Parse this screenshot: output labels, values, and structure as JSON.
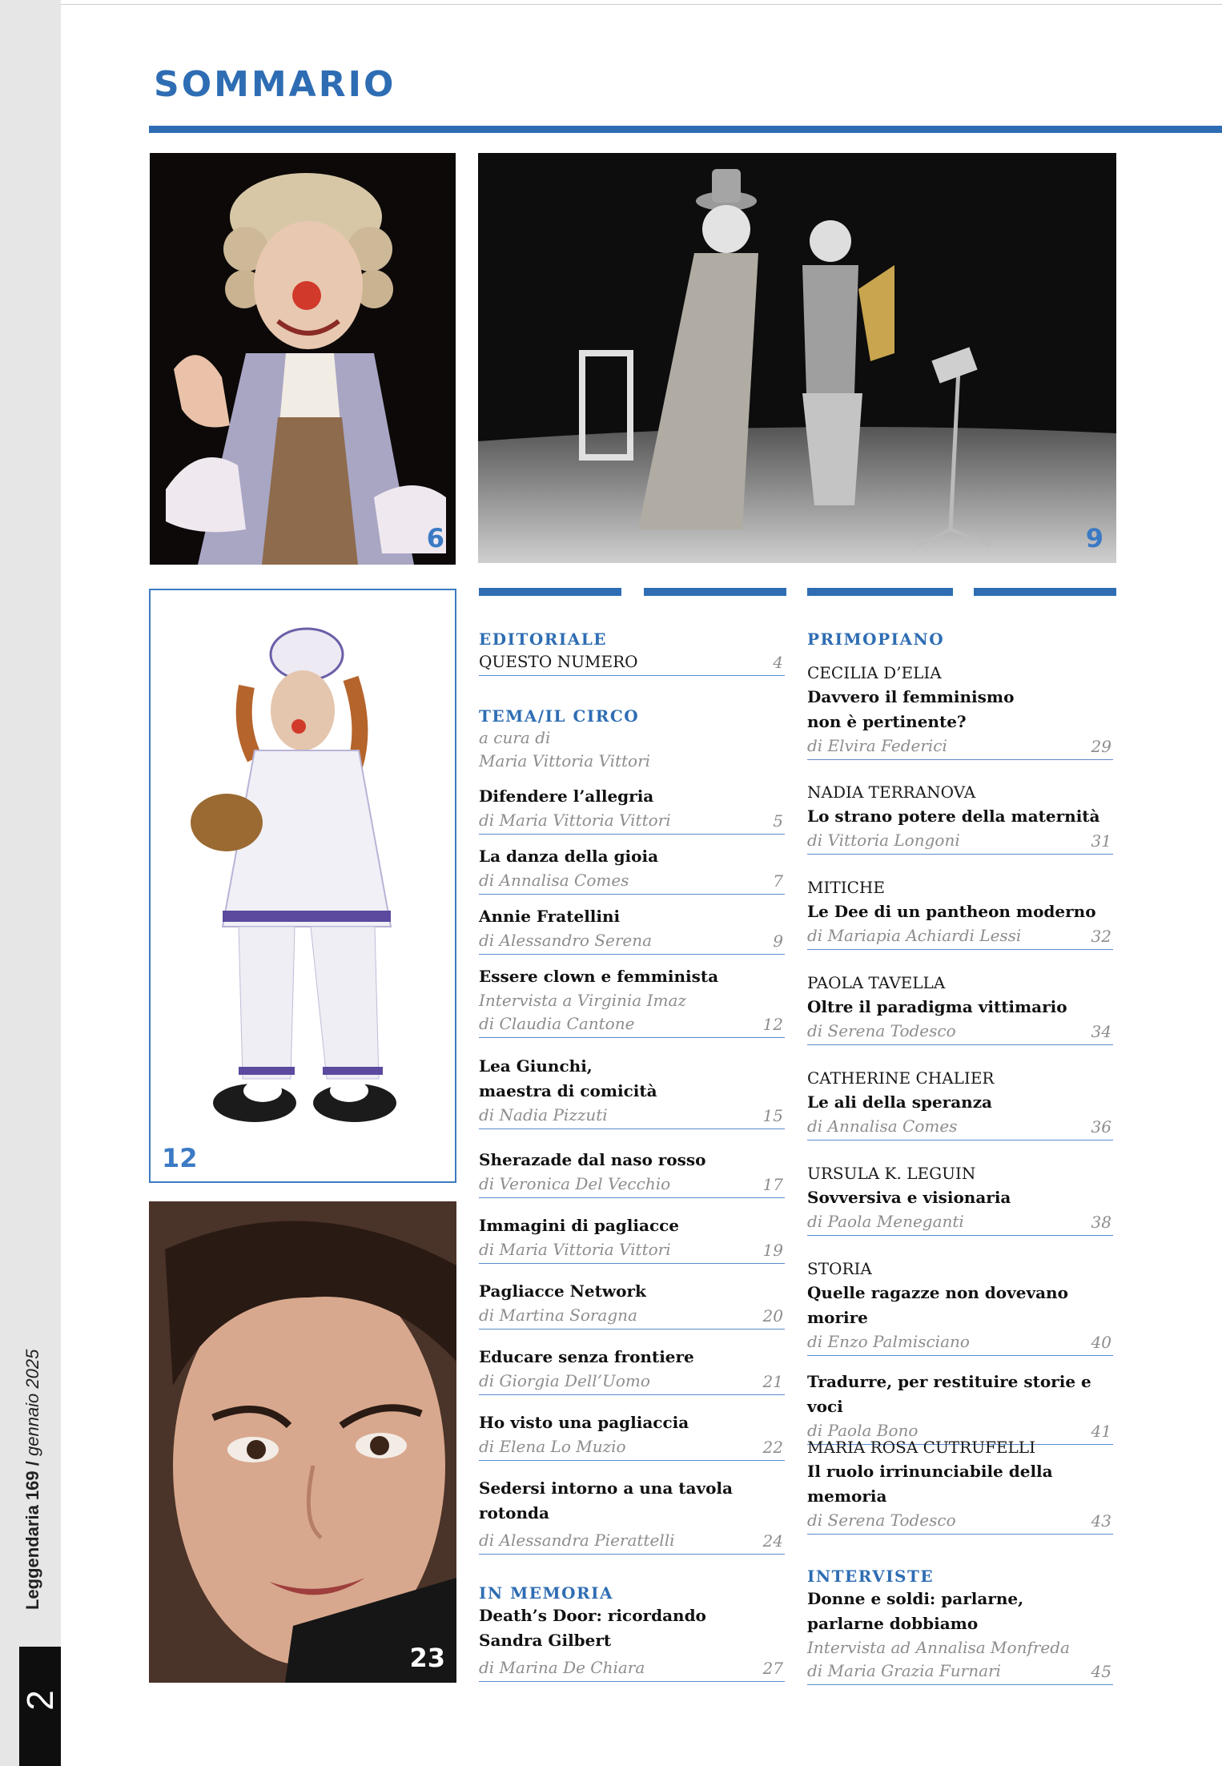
{
  "title": "SOMMARIO",
  "spine": {
    "magazine": "Leggendaria 169 /",
    "date": "gennaio 2025",
    "page_number": "2"
  },
  "photos": [
    {
      "number": "6",
      "subject": "clown in baroque costume with curly wig"
    },
    {
      "number": "9",
      "subject": "two clowns on stage, one playing saxophone"
    },
    {
      "number": "12",
      "subject": "female clown with bag and striped costume"
    },
    {
      "number": "23",
      "subject": "close-up portrait of a woman"
    }
  ],
  "left_column": {
    "editoriale": {
      "heading": "EDITORIALE",
      "item": "QUESTO NUMERO",
      "page": "4"
    },
    "tema": {
      "heading": "TEMA/IL CIRCO",
      "curator_line1": "a cura di",
      "curator_line2": "Maria Vittoria Vittori",
      "items": [
        {
          "title": "Difendere l’allegria",
          "author": "di Maria Vittoria Vittori",
          "page": "5"
        },
        {
          "title": "La danza della gioia",
          "author": "di Annalisa Comes",
          "page": "7"
        },
        {
          "title": "Annie Fratellini",
          "author": "di Alessandro Serena",
          "page": "9"
        },
        {
          "title": "Essere clown e femminista",
          "sub": "Intervista a Virginia Imaz",
          "author": "di Claudia Cantone",
          "page": "12"
        },
        {
          "title": "Lea Giunchi,",
          "title2": "maestra di comicità",
          "author": "di Nadia Pizzuti",
          "page": "15"
        },
        {
          "title": "Sherazade dal naso rosso",
          "author": "di Veronica Del Vecchio",
          "page": "17"
        },
        {
          "title": "Immagini di pagliacce",
          "author": "di Maria Vittoria Vittori",
          "page": "19"
        },
        {
          "title": "Pagliacce Network",
          "author": "di Martina Soragna",
          "page": "20"
        },
        {
          "title": "Educare senza frontiere",
          "author": "di Giorgia Dell’Uomo",
          "page": "21"
        },
        {
          "title": "Ho visto una pagliaccia",
          "author": "di Elena Lo Muzio",
          "page": "22"
        },
        {
          "title": "Sedersi intorno a una tavola",
          "title2": "rotonda",
          "author": "di Alessandra Pierattelli",
          "page": "24"
        }
      ]
    },
    "memoria": {
      "heading": "IN MEMORIA",
      "title": "Death’s Door: ricordando",
      "title2": "Sandra Gilbert",
      "author": "di Marina De Chiara",
      "page": "27"
    }
  },
  "right_column": {
    "primopiano": {
      "heading": "PRIMOPIANO",
      "items": [
        {
          "name": "CECILIA D’ELIA",
          "title": "Davvero il femminismo",
          "title2": "non è pertinente?",
          "author": "di Elvira Federici",
          "page": "29"
        },
        {
          "name": "NADIA TERRANOVA",
          "title": "Lo strano potere della maternità",
          "author": "di Vittoria Longoni",
          "page": "31"
        },
        {
          "name": "MITICHE",
          "title": "Le Dee di un pantheon moderno",
          "author": "di Mariapia Achiardi Lessi",
          "page": "32"
        },
        {
          "name": "PAOLA TAVELLA",
          "title": "Oltre il paradigma vittimario",
          "author": "di Serena Todesco",
          "page": "34"
        },
        {
          "name": "CATHERINE CHALIER",
          "title": "Le ali della speranza",
          "author": "di Annalisa Comes",
          "page": "36"
        },
        {
          "name": "URSULA K. LEGUIN",
          "title": "Sovversiva e visionaria",
          "author": "di Paola Meneganti",
          "page": "38"
        },
        {
          "name": "STORIA",
          "title": "Quelle ragazze non dovevano",
          "title2": "morire",
          "author": "di Enzo Palmisciano",
          "page": "40"
        },
        {
          "title": "Tradurre, per restituire storie e voci",
          "author": "di Paola Bono",
          "page": "41"
        },
        {
          "name": "MARIA ROSA CUTRUFELLI",
          "title": "Il ruolo irrinunciabile della",
          "title2": "memoria",
          "author": "di Serena Todesco",
          "page": "43"
        }
      ]
    },
    "interviste": {
      "heading": "INTERVISTE",
      "title": "Donne e soldi: parlarne,",
      "title2": "parlarne dobbiamo",
      "sub": "Intervista ad Annalisa Monfreda",
      "author": "di Maria Grazia Furnari",
      "page": "45"
    }
  },
  "colors": {
    "accent": "#2e6db3",
    "rule": "#5b8ccc",
    "author_gray": "#8d8d8d"
  }
}
